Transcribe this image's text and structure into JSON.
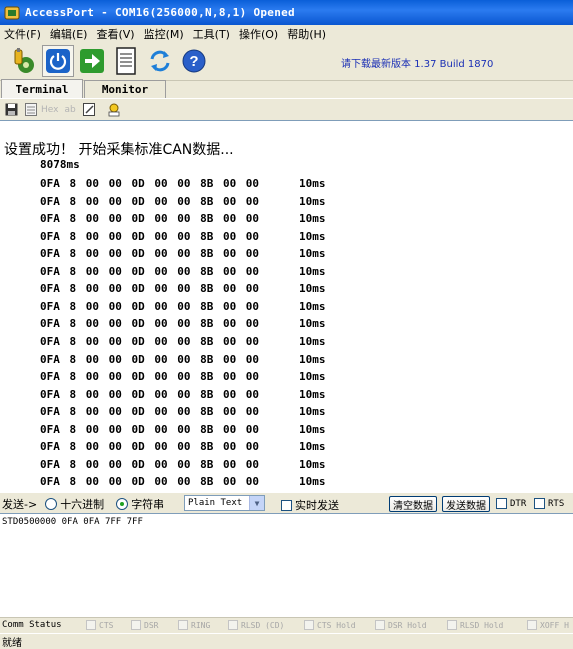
{
  "window": {
    "title": "AccessPort - COM16(256000,N,8,1) Opened"
  },
  "menu": [
    "文件(F)",
    "编辑(E)",
    "查看(V)",
    "监控(M)",
    "工具(T)",
    "操作(O)",
    "帮助(H)"
  ],
  "toolbar": {
    "icons": [
      "connect-icon",
      "power-icon",
      "green-arrow-icon",
      "document-icon",
      "refresh-arrows-icon",
      "help-icon"
    ],
    "update_text": "请下载最新版本 1.37 Build 1870"
  },
  "tabs": [
    "Terminal",
    "Monitor"
  ],
  "subtoolbar": {
    "hex_label": "Hex",
    "ab_label": "ab"
  },
  "terminal": {
    "header": "设置成功！  开始采集标准CAN数据...",
    "time": "8078ms",
    "rows": [
      {
        "data": "0FA 8 00 00 0D 00 00 8B 00 00",
        "delta": "10ms"
      },
      {
        "data": "0FA 8 00 00 0D 00 00 8B 00 00",
        "delta": "10ms"
      },
      {
        "data": "0FA 8 00 00 0D 00 00 8B 00 00",
        "delta": "10ms"
      },
      {
        "data": "0FA 8 00 00 0D 00 00 8B 00 00",
        "delta": "10ms"
      },
      {
        "data": "0FA 8 00 00 0D 00 00 8B 00 00",
        "delta": "10ms"
      },
      {
        "data": "0FA 8 00 00 0D 00 00 8B 00 00",
        "delta": "10ms"
      },
      {
        "data": "0FA 8 00 00 0D 00 00 8B 00 00",
        "delta": "10ms"
      },
      {
        "data": "0FA 8 00 00 0D 00 00 8B 00 00",
        "delta": "10ms"
      },
      {
        "data": "0FA 8 00 00 0D 00 00 8B 00 00",
        "delta": "10ms"
      },
      {
        "data": "0FA 8 00 00 0D 00 00 8B 00 00",
        "delta": "10ms"
      },
      {
        "data": "0FA 8 00 00 0D 00 00 8B 00 00",
        "delta": "10ms"
      },
      {
        "data": "0FA 8 00 00 0D 00 00 8B 00 00",
        "delta": "10ms"
      },
      {
        "data": "0FA 8 00 00 0D 00 00 8B 00 00",
        "delta": "10ms"
      },
      {
        "data": "0FA 8 00 00 0D 00 00 8B 00 00",
        "delta": "10ms"
      },
      {
        "data": "0FA 8 00 00 0D 00 00 8B 00 00",
        "delta": "10ms"
      },
      {
        "data": "0FA 8 00 00 0D 00 00 8B 00 00",
        "delta": "10ms"
      },
      {
        "data": "0FA 8 00 00 0D 00 00 8B 00 00",
        "delta": "10ms"
      },
      {
        "data": "0FA 8 00 00 0D 00 00 8B 00 00",
        "delta": "10ms"
      }
    ]
  },
  "send": {
    "label": "发送->",
    "radio_hex": "十六进制",
    "radio_string": "字符串",
    "selected_format": "Plain Text",
    "realtime_label": "实时发送",
    "clear_button": "清空数据",
    "send_button": "发送数据",
    "dtr_label": "DTR",
    "rts_label": "RTS",
    "content": "STD0500000 0FA 0FA 7FF 7FF"
  },
  "status": {
    "comm_label": "Comm Status",
    "signals": [
      "CTS",
      "DSR",
      "RING",
      "RLSD (CD)",
      "CTS Hold",
      "DSR Hold",
      "RLSD Hold",
      "XOFF H"
    ],
    "ready": "就绪"
  }
}
